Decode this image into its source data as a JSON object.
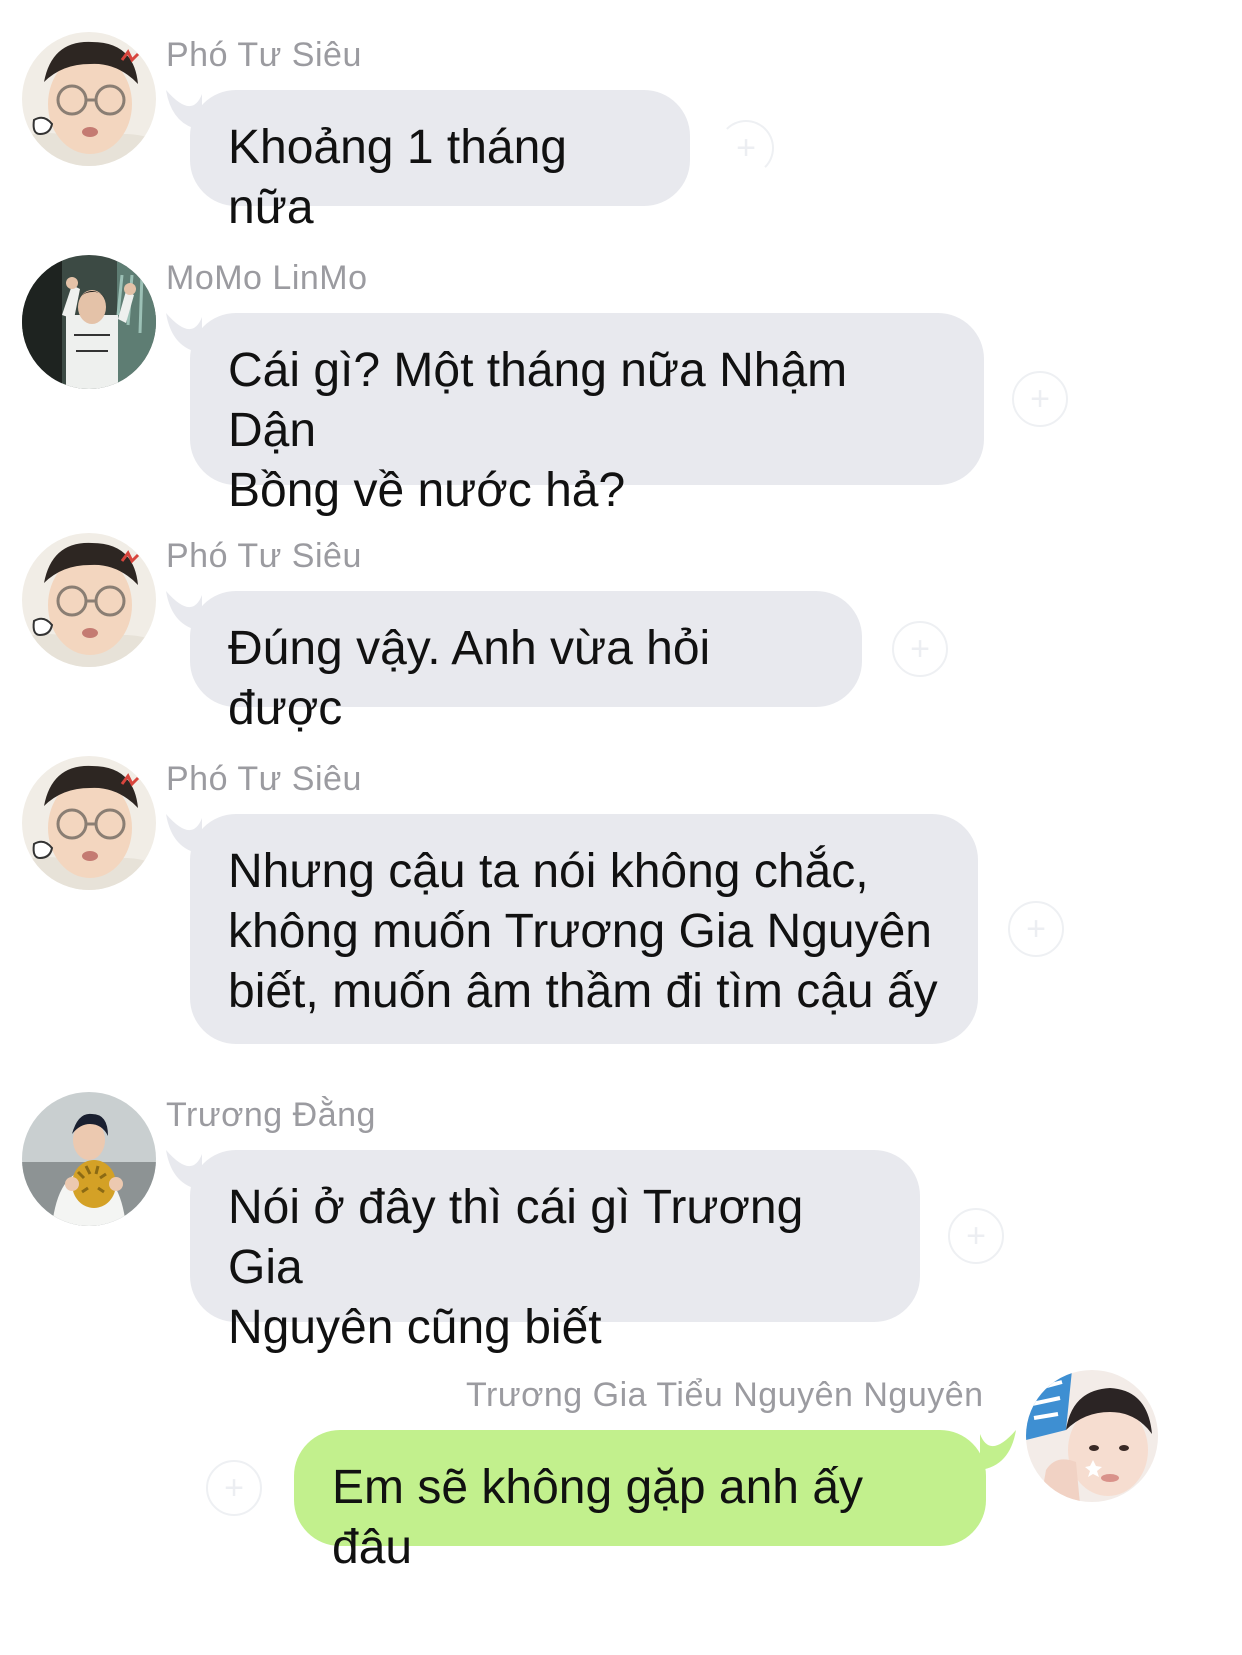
{
  "colors": {
    "incoming_bubble": "#e8e9ee",
    "outgoing_bubble": "#c2f08d",
    "sender_name": "#9b9ba0",
    "message_text": "#111111"
  },
  "messages": [
    {
      "sender": "Phó Tư Siêu",
      "text": "Khoảng 1 tháng nữa",
      "direction": "incoming",
      "avatar": "glasses-boy-avatar"
    },
    {
      "sender": "MoMo LinMo",
      "text": "Cái gì? Một tháng nữa Nhậm Dận\nBồng về nước hả?",
      "direction": "incoming",
      "avatar": "waving-boy-avatar"
    },
    {
      "sender": "Phó Tư Siêu",
      "text": "Đúng vậy. Anh vừa hỏi được",
      "direction": "incoming",
      "avatar": "glasses-boy-avatar"
    },
    {
      "sender": "Phó Tư Siêu",
      "text": "Nhưng cậu ta nói không chắc,\nkhông muốn Trương Gia Nguyên\nbiết, muốn âm thầm đi tìm cậu ấy",
      "direction": "incoming",
      "avatar": "glasses-boy-avatar"
    },
    {
      "sender": "Trương Đằng",
      "text": "Nói ở đây thì cái gì Trương Gia\nNguyên cũng biết",
      "direction": "incoming",
      "avatar": "durian-boy-avatar"
    },
    {
      "sender": "Trương Gia Tiểu Nguyên Nguyên",
      "text": "Em sẽ không gặp anh ấy đâu",
      "direction": "outgoing",
      "avatar": "selfie-boy-avatar"
    }
  ],
  "reaction_icon": "+"
}
